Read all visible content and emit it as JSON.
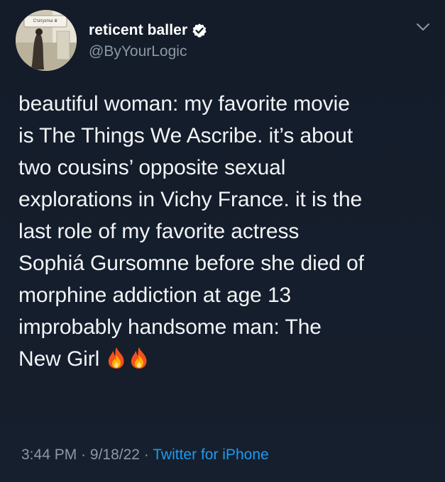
{
  "author": {
    "display_name": "reticent baller",
    "handle": "@ByYourLogic",
    "verified": true,
    "avatar_sign_text": "Статуэтка ♛"
  },
  "icons": {
    "verified": "verified-badge-icon",
    "more": "chevron-down-icon",
    "emoji": "fire-emoji"
  },
  "tweet": {
    "lines": [
      "beautiful woman: my favorite movie",
      "is The Things We Ascribe. it’s about",
      "two cousins’ opposite sexual",
      "explorations in Vichy France. it is the",
      "last role of my favorite actress",
      "Sophiá Gursomne before she died of",
      "morphine addiction at age 13",
      "improbably handsome man: The",
      "New Girl"
    ]
  },
  "meta": {
    "time": "3:44 PM",
    "sep1": " · ",
    "date": "9/18/22",
    "sep2": " · ",
    "source": "Twitter for iPhone"
  },
  "colors": {
    "background": "#15202b",
    "text": "#f2f4f6",
    "secondary": "#8b98a5",
    "link": "#1d9bf0"
  }
}
